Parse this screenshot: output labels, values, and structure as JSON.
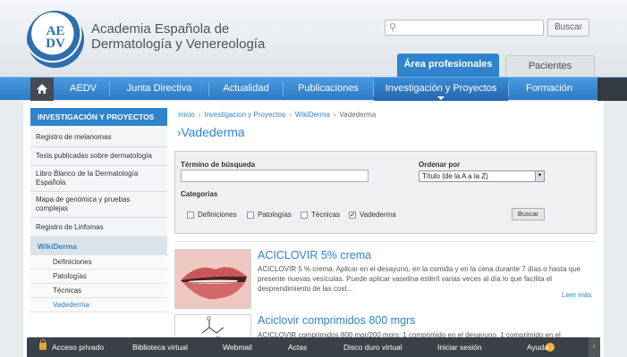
{
  "header": {
    "logo_letters": "AE DV",
    "title_line1": "Academia Española de",
    "title_line2": "Dermatología y Venereología",
    "search_placeholder": "",
    "search_button": "Buscar",
    "tabs": [
      {
        "label": "Área profesionales",
        "active": true
      },
      {
        "label": "Pacientes",
        "active": false
      }
    ]
  },
  "nav": {
    "home_icon": "home-icon",
    "items": [
      {
        "label": "AEDV"
      },
      {
        "label": "Junta Directiva"
      },
      {
        "label": "Actualidad"
      },
      {
        "label": "Publicaciones"
      },
      {
        "label": "Investigación y Proyectos",
        "active": true
      },
      {
        "label": "Formación"
      }
    ]
  },
  "sidebar": {
    "heading": "INVESTIGACIÓN Y PROYECTOS",
    "items": [
      {
        "label": "Registro de melanomas"
      },
      {
        "label": "Tesis publicadas sobre dermatología"
      },
      {
        "label": "Libro Blanco de la Dermatología Española"
      },
      {
        "label": "Mapa de genómica y pruebas complejas"
      },
      {
        "label": "Registro de Linfomas"
      }
    ],
    "wiki": "WikiDerma",
    "subitems": [
      {
        "label": "Definiciones"
      },
      {
        "label": "Patologías"
      },
      {
        "label": "Técnicas"
      },
      {
        "label": "Vadederma",
        "active": true
      }
    ]
  },
  "breadcrumb": [
    {
      "label": "Inicio",
      "link": true
    },
    {
      "label": "Investigacion y Proyectos",
      "link": true
    },
    {
      "label": "WikiDerma",
      "link": true
    },
    {
      "label": "Vadederma",
      "link": false
    }
  ],
  "page_title": "Vadederma",
  "filter": {
    "search_label": "Término de búsqueda",
    "search_value": "",
    "order_label": "Ordenar por",
    "order_value": "Título (de la A a la Z)",
    "categories_label": "Categorias",
    "categories": [
      {
        "label": "Definiciones",
        "checked": false
      },
      {
        "label": "Patologías",
        "checked": false
      },
      {
        "label": "Técnicas",
        "checked": false
      },
      {
        "label": "Vadederma",
        "checked": true
      }
    ],
    "button": "Buscar"
  },
  "articles": [
    {
      "title": "ACICLOVIR 5% crema",
      "text": "ACICLOVIR 5 % crema. Aplicar en el desayuno, en la comida y en la cena durante 7 días o hasta que presente nuevas vesículas. Puede aplicar vaselina estéril varias veces al día lo que facilita el desprendimiento de las cost...",
      "read_more": "Leer más"
    },
    {
      "title": "Aciclovir comprimidos 800 mgrs",
      "text": "ACICLOVIR comprimidos 800 mgr/200 mgrs: 1 comprimido en el desayuno, 1 comprimido en el"
    }
  ],
  "bottom_bar": {
    "items": [
      {
        "label": "Acceso privado",
        "icon": "lock-icon"
      },
      {
        "label": "Biblioteca virtual"
      },
      {
        "label": "Webmail"
      },
      {
        "label": "Actas"
      },
      {
        "label": "Disco duro virtual"
      },
      {
        "label": "Iniciar sesión"
      },
      {
        "label": "Ayuda",
        "icon": "help-icon"
      }
    ],
    "collapse_icon": "chevron-left-icon"
  },
  "colors": {
    "accent": "#2f84cc",
    "nav_dark": "#444b52",
    "bottom_bar": "#3b4148",
    "lock": "#e6a531"
  }
}
